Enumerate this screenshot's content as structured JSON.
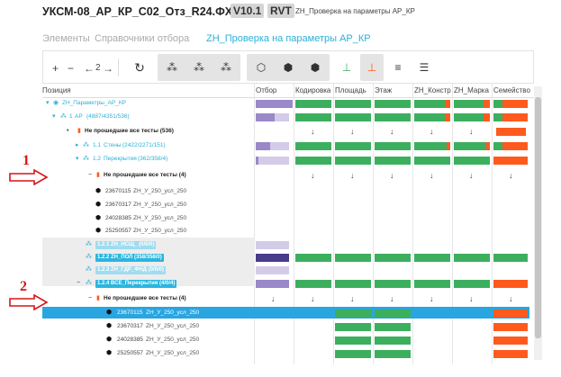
{
  "header": {
    "title": "УКСМ-08_АР_КР_С02_Отз_R24.ФХ",
    "version": "V10.1",
    "format": "RVT",
    "subtitle": "ZH_Проверка на параметры АР_КР"
  },
  "nav": {
    "item1": "Элементы",
    "item2": "Справочники отбора",
    "item3": "ZH_Проверка на параметры АР_КР"
  },
  "toolbar": {
    "plus": "+",
    "minus": "−",
    "back": "←",
    "level": "2",
    "forward": "→"
  },
  "columns": {
    "position": "Позиция",
    "filter": "Отбор",
    "coding": "Кодировка",
    "area": "Площадь",
    "floor": "Этаж",
    "construct": "ZH_Констр",
    "mark": "ZH_Марка",
    "family": "Семейство"
  },
  "rows": [
    {
      "label": "ZH_Параметры_АР_КР"
    },
    {
      "num": "1",
      "label": "АР",
      "count": "(4887/4351/536)"
    },
    {
      "label": "Не прошедшие все тесты (536)"
    },
    {
      "num": "1.1",
      "label": "Стены",
      "count": "(2422/2271/151)"
    },
    {
      "num": "1.2",
      "label": "Перекрытия",
      "count": "(362/358/4)"
    },
    {
      "label": "Не прошедшие все тесты (4)"
    },
    {
      "id": "23670115",
      "label": "ZH_У_250_усл_250"
    },
    {
      "id": "23670317",
      "label": "ZH_У_250_усл_250"
    },
    {
      "id": "24028385",
      "label": "ZH_У_250_усл_250"
    },
    {
      "id": "25250557",
      "label": "ZH_У_250_усл_250"
    },
    {
      "label": "1.2.1 ZH_НСЩ_ (0/0/0)"
    },
    {
      "label": "1.2.2 ZH_ПОЛ (358/358/0)"
    },
    {
      "label": "1.2.3 ZH_ГДР_ФНД (0/0/0)"
    },
    {
      "label": "1.2.4 ВСЕ_Перекрытия (4/0/4)"
    },
    {
      "label": "Не прошедшие все тесты (4)"
    },
    {
      "id": "23670115",
      "label": "ZH_У_250_усл_250"
    },
    {
      "id": "23670317",
      "label": "ZH_У_250_усл_250"
    },
    {
      "id": "24028385",
      "label": "ZH_У_250_усл_250"
    },
    {
      "id": "25250557",
      "label": "ZH_У_250_усл_250"
    }
  ],
  "annotations": {
    "one": "1",
    "two": "2"
  },
  "colors": {
    "green": "#3caf5f",
    "red": "#ff5a1e",
    "purple": "#9a88c9",
    "lightPurple": "#d3cbe8",
    "darkPurple": "#4a3c8c",
    "selected": "#29a5e0",
    "accent": "#2ab0d8"
  }
}
